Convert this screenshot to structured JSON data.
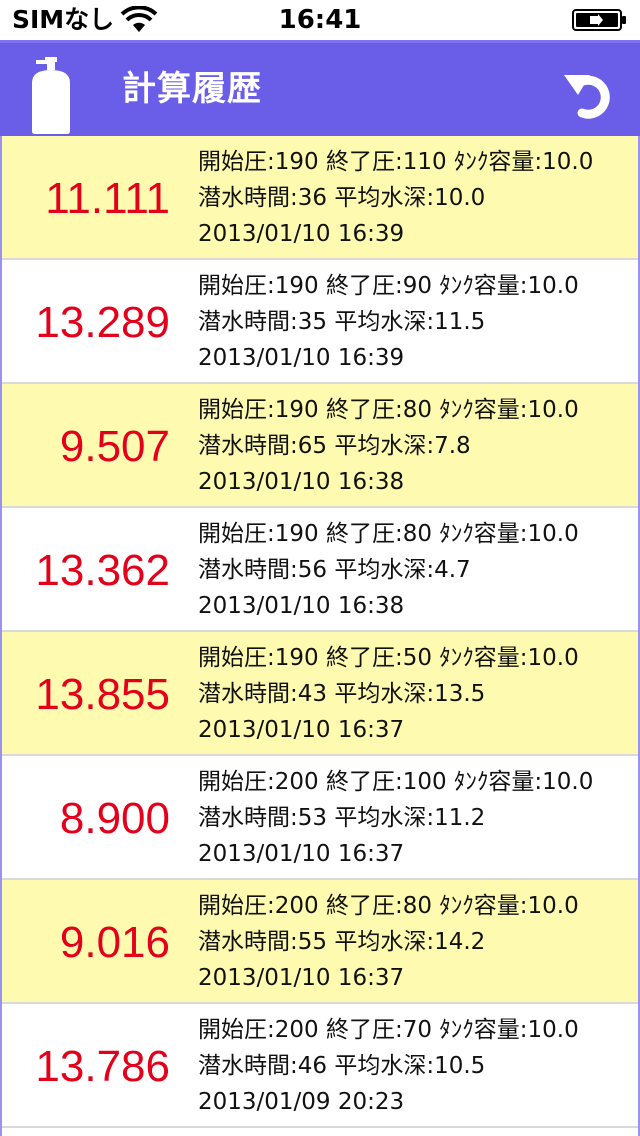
{
  "status_bar": {
    "carrier": "SIMなし",
    "time": "16:41"
  },
  "nav": {
    "title": "計算履歴",
    "left_icon": "gas-tank-icon",
    "right_icon": "undo-arrow-icon",
    "bar_color": "#6a5de8"
  },
  "colors": {
    "value": "#e3001a",
    "row_highlight": "#fefbb0"
  },
  "history": [
    {
      "value": "11.111",
      "params": "開始圧:190 終了圧:110 ﾀﾝｸ容量:10.0",
      "dive": "潜水時間:36 平均水深:10.0",
      "datetime": "2013/01/10 16:39"
    },
    {
      "value": "13.289",
      "params": "開始圧:190 終了圧:90 ﾀﾝｸ容量:10.0",
      "dive": "潜水時間:35 平均水深:11.5",
      "datetime": "2013/01/10 16:39"
    },
    {
      "value": "9.507",
      "params": "開始圧:190 終了圧:80 ﾀﾝｸ容量:10.0",
      "dive": "潜水時間:65 平均水深:7.8",
      "datetime": "2013/01/10 16:38"
    },
    {
      "value": "13.362",
      "params": "開始圧:190 終了圧:80 ﾀﾝｸ容量:10.0",
      "dive": "潜水時間:56 平均水深:4.7",
      "datetime": "2013/01/10 16:38"
    },
    {
      "value": "13.855",
      "params": "開始圧:190 終了圧:50 ﾀﾝｸ容量:10.0",
      "dive": "潜水時間:43 平均水深:13.5",
      "datetime": "2013/01/10 16:37"
    },
    {
      "value": "8.900",
      "params": "開始圧:200 終了圧:100 ﾀﾝｸ容量:10.0",
      "dive": "潜水時間:53 平均水深:11.2",
      "datetime": "2013/01/10 16:37"
    },
    {
      "value": "9.016",
      "params": "開始圧:200 終了圧:80 ﾀﾝｸ容量:10.0",
      "dive": "潜水時間:55 平均水深:14.2",
      "datetime": "2013/01/10 16:37"
    },
    {
      "value": "13.786",
      "params": "開始圧:200 終了圧:70 ﾀﾝｸ容量:10.0",
      "dive": "潜水時間:46 平均水深:10.5",
      "datetime": "2013/01/09 20:23"
    }
  ]
}
